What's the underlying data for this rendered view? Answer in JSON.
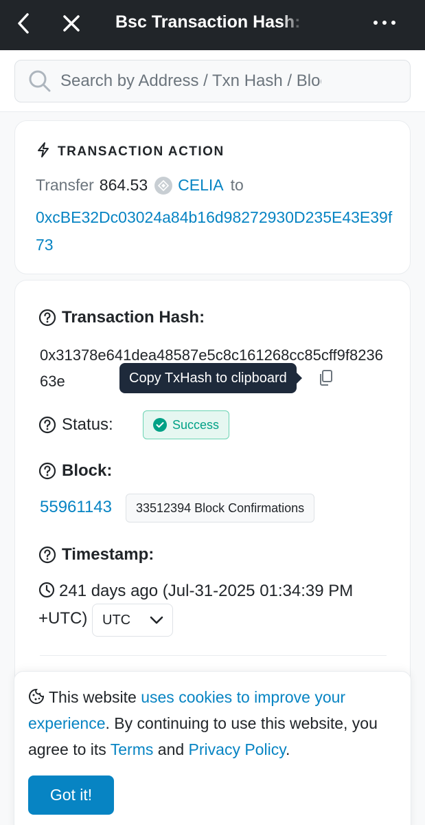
{
  "appbar": {
    "title": "Bsc Transaction Hash:",
    "back_icon": "chevron-left-icon",
    "close_icon": "close-icon",
    "more_icon": "more-horizontal-icon"
  },
  "search": {
    "placeholder": "Search by Address / Txn Hash / Block / Token / Domain Name"
  },
  "action": {
    "heading": "TRANSACTION ACTION",
    "verb": "Transfer",
    "amount": "864.53",
    "token": "CELIA",
    "to_word": "to",
    "to_address": "0xcBE32Dc03024a84b16d98272930D235E43E39f73"
  },
  "details": {
    "hash_label": "Transaction Hash:",
    "hash_value": "0x31378e641dea48587e5c8c161268cc85cff9f823663e",
    "copy_tooltip": "Copy TxHash to clipboard",
    "status_label": "Status:",
    "status_value": "Success",
    "block_label": "Block:",
    "block_number": "55961143",
    "block_confirmations": "33512394 Block Confirmations",
    "timestamp_label": "Timestamp:",
    "timestamp_value": "241 days ago (Jul-31-2025 01:34:39 PM +UTC)",
    "timezone": "UTC"
  },
  "cookie": {
    "text_start": "This website ",
    "link_improve": "uses cookies to improve your experience",
    "text_mid": ". By continuing to use this website, you agree to its ",
    "link_terms": "Terms",
    "text_and": " and ",
    "link_privacy": "Privacy Policy",
    "text_end": ".",
    "button": "Got it!"
  },
  "colors": {
    "appbar_bg": "#212529",
    "link": "#0784c3",
    "success": "#00a186"
  }
}
